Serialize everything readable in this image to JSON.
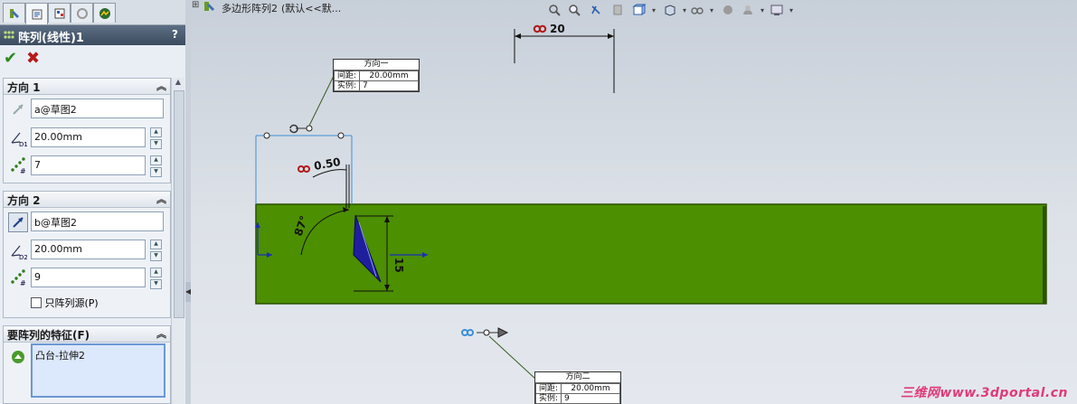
{
  "panel": {
    "tabs": [
      {
        "icon": "feature-manager-icon"
      },
      {
        "icon": "property-manager-icon"
      },
      {
        "icon": "configuration-manager-icon"
      },
      {
        "icon": "dimxpert-icon"
      },
      {
        "icon": "display-manager-icon"
      }
    ],
    "title": "阵列(线性)1",
    "help": "?",
    "ok_icon": "✔",
    "cancel_icon": "✖",
    "direction1": {
      "header": "方向 1",
      "reference": "a@草图2",
      "spacing": "20.00mm",
      "instances": "7"
    },
    "direction2": {
      "header": "方向 2",
      "reference": "b@草图2",
      "spacing": "20.00mm",
      "instances": "9",
      "seed_only_label": "只阵列源(P)"
    },
    "features": {
      "header": "要阵列的特征(F)",
      "items": [
        "凸台-拉伸2"
      ]
    },
    "collapse_glyph": "︽",
    "icon_labels": {
      "d1": "D1",
      "d2": "D2",
      "hash": "#"
    }
  },
  "tree": {
    "expander": "⊞",
    "part_label": "多边形阵列2",
    "config_label": "(默认<<默..."
  },
  "viewport": {
    "dim_top": "20",
    "dim_angle_small": "0.50",
    "dim_angle": "87°",
    "dim_height": "15",
    "callout1": {
      "title": "方向一",
      "spacing_label": "间距:",
      "spacing": "20.00mm",
      "instances_label": "实例:",
      "instances": "7"
    },
    "callout2": {
      "title": "方向二",
      "spacing_label": "间距:",
      "spacing": "20.00mm",
      "instances_label": "实例:",
      "instances": "9"
    },
    "colors": {
      "body": "#4c8f00",
      "body_edge": "#2b5200",
      "triangle": "#1f1f9e",
      "link": "#b01818"
    }
  },
  "watermark": "三维网www.3dportal.cn"
}
